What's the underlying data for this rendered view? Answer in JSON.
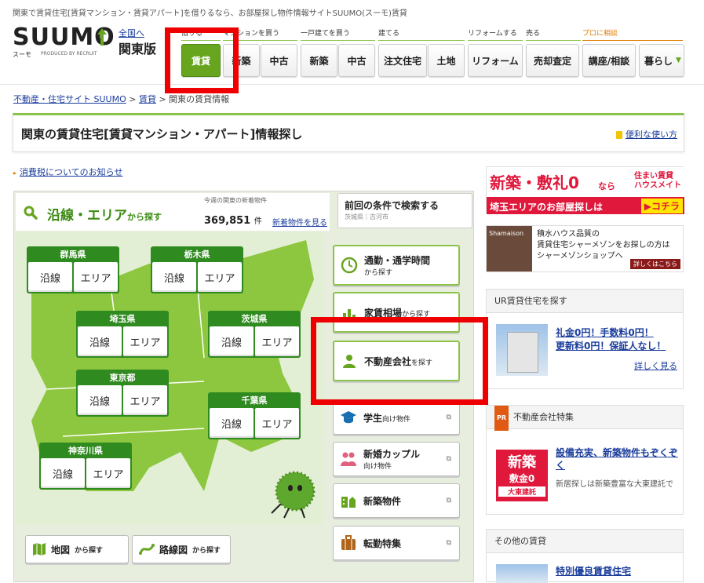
{
  "header": {
    "tagline": "関東で賃貸住宅[賃貸マンション・賃貸アパート]を借りるなら、お部屋探し物件情報サイトSUUMO(スーモ)賃貸",
    "logo_text": "SUUMO",
    "logo_sub": "スーモ",
    "logo_produced": "PRODUCED BY RECRUIT",
    "region_link": "全国へ",
    "region_name": "関東版"
  },
  "nav": {
    "categories": [
      "借りる",
      "マンションを買う",
      "一戸建てを買う",
      "建てる",
      "リフォームする",
      "売る",
      "プロに相談"
    ],
    "buttons": [
      "賃貸",
      "新築",
      "中古",
      "新築",
      "中古",
      "注文住宅",
      "土地",
      "リフォーム",
      "売却査定",
      "講座/相談",
      "暮らし"
    ],
    "more_arrow": "▼"
  },
  "breadcrumb": {
    "items": [
      "不動産・住宅サイト SUUMO",
      "賃貸",
      "関東の賃貸情報"
    ],
    "separator": ">"
  },
  "page_title": "関東の賃貸住宅[賃貸マンション・アパート]情報探し",
  "howto_link": "便利な使い方",
  "notice_link": "消費税についてのお知らせ",
  "search": {
    "head_main": "沿線・エリア",
    "head_suffix": "から探す",
    "stats_caption": "今週の関東の新着物件",
    "stats_count": "369,851",
    "stats_unit": "件",
    "stats_link": "新着物件を見る",
    "prev_title": "前回の条件で検索する",
    "prev_sub": "茨城県｜古河市",
    "line_label": "沿線",
    "area_label": "エリア",
    "prefectures": [
      "群馬県",
      "栃木県",
      "埼玉県",
      "茨城県",
      "東京都",
      "千葉県",
      "神奈川県"
    ],
    "bottom_buttons": [
      {
        "main": "地図",
        "suffix": "から探す"
      },
      {
        "main": "路線図",
        "suffix": "から探す"
      }
    ]
  },
  "side_buttons": [
    {
      "main": "通勤・通学時間",
      "suffix": "から探す"
    },
    {
      "main": "家賃相場",
      "suffix": "から探す"
    },
    {
      "main": "不動産会社",
      "suffix": "を探す"
    },
    {
      "main": "学生",
      "suffix": "向け物件"
    },
    {
      "main": "新婚カップル",
      "suffix": "向け物件"
    },
    {
      "main": "新築物件",
      "suffix": ""
    },
    {
      "main": "転勤特集",
      "suffix": ""
    }
  ],
  "ads": {
    "ad1_top": "新築・敷礼0",
    "ad1_nara": "なら",
    "ad1_brand": "住まい賃貸 ハウスメイト",
    "ad1_bottom": "埼玉エリアのお部屋探しは",
    "ad1_cta": "▶コチラ",
    "ad2_line1": "積水ハウス品質の",
    "ad2_line2": "賃貸住宅シャーメゾンをお探しの方は",
    "ad2_line3": "シャーメゾンショップへ",
    "ad2_cta": "詳しくはこちら",
    "ad2_logo": "Shamaison"
  },
  "ur_box": {
    "title": "UR賃貸住宅を探す",
    "link1": "礼金0円！手数料0円！",
    "link2": "更新料0円！保証人なし！",
    "more": "詳しく見る"
  },
  "pr_box": {
    "badge": "PR",
    "title": "不動産会社特集",
    "link": "設備充実、新築物件もぞくぞく",
    "text": "新居探しは新築豊富な大東建託で",
    "thumb_top": "新築",
    "thumb_mid": "敷金0",
    "thumb_brand": "大東建託"
  },
  "other_box": {
    "title": "その他の賃貸",
    "link": "特別優良賃貸住宅"
  },
  "colors": {
    "accent_green": "#67a51f",
    "pref_green": "#2f8a1f",
    "highlight_red": "#ef0000"
  }
}
